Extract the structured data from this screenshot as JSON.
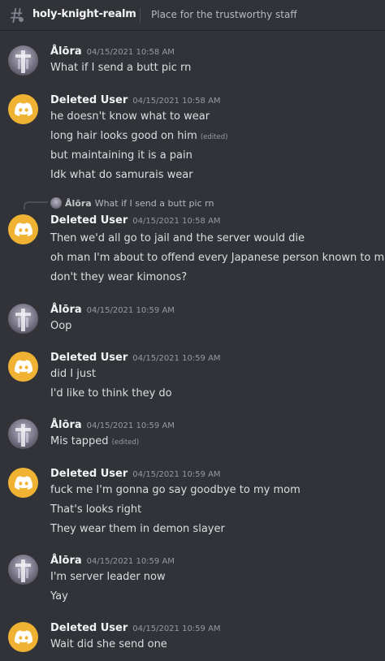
{
  "header": {
    "channel_name": "holy-knight-realm",
    "topic": "Place for the trustworthy staff",
    "icon": "threads-hash-icon"
  },
  "messages": [
    {
      "author": "Ålōra",
      "timestamp": "04/15/2021 10:58 AM",
      "avatar": "alora-photo",
      "lines": [
        {
          "text": "What if I send a butt pic rn"
        }
      ]
    },
    {
      "author": "Deleted User",
      "timestamp": "04/15/2021 10:58 AM",
      "avatar": "discord-logo",
      "lines": [
        {
          "text": "he doesn't know what to wear"
        },
        {
          "text": "long hair looks good on him",
          "edited": "(edited)"
        },
        {
          "text": "but maintaining it is a pain"
        },
        {
          "text": "Idk what do samurais wear"
        }
      ]
    },
    {
      "author": "Deleted User",
      "timestamp": "04/15/2021 10:58 AM",
      "avatar": "discord-logo",
      "reply": {
        "author": "Ålōra",
        "text": "What if I send a butt pic rn"
      },
      "lines": [
        {
          "text": "Then we'd all go to jail and the server would die"
        },
        {
          "text": "oh man I'm about to offend every Japanese person known to man"
        },
        {
          "text": "don't they wear kimonos?"
        }
      ]
    },
    {
      "author": "Ålōra",
      "timestamp": "04/15/2021 10:59 AM",
      "avatar": "alora-photo",
      "lines": [
        {
          "text": "Oop"
        }
      ]
    },
    {
      "author": "Deleted User",
      "timestamp": "04/15/2021 10:59 AM",
      "avatar": "discord-logo",
      "lines": [
        {
          "text": "did I just"
        },
        {
          "text": "I'd like to think they do"
        }
      ]
    },
    {
      "author": "Ålōra",
      "timestamp": "04/15/2021 10:59 AM",
      "avatar": "alora-photo",
      "lines": [
        {
          "text": "Mis tapped",
          "edited": "(edited)"
        }
      ]
    },
    {
      "author": "Deleted User",
      "timestamp": "04/15/2021 10:59 AM",
      "avatar": "discord-logo",
      "lines": [
        {
          "text": "fuck me I'm gonna go say goodbye to my mom"
        },
        {
          "text": "That's looks right"
        },
        {
          "text": "They wear them in demon slayer"
        }
      ]
    },
    {
      "author": "Ålōra",
      "timestamp": "04/15/2021 10:59 AM",
      "avatar": "alora-photo",
      "lines": [
        {
          "text": "I'm server leader now"
        },
        {
          "text": "Yay"
        }
      ]
    },
    {
      "author": "Deleted User",
      "timestamp": "04/15/2021 10:59 AM",
      "avatar": "discord-logo",
      "lines": [
        {
          "text": "Wait did she send one"
        }
      ]
    }
  ]
}
